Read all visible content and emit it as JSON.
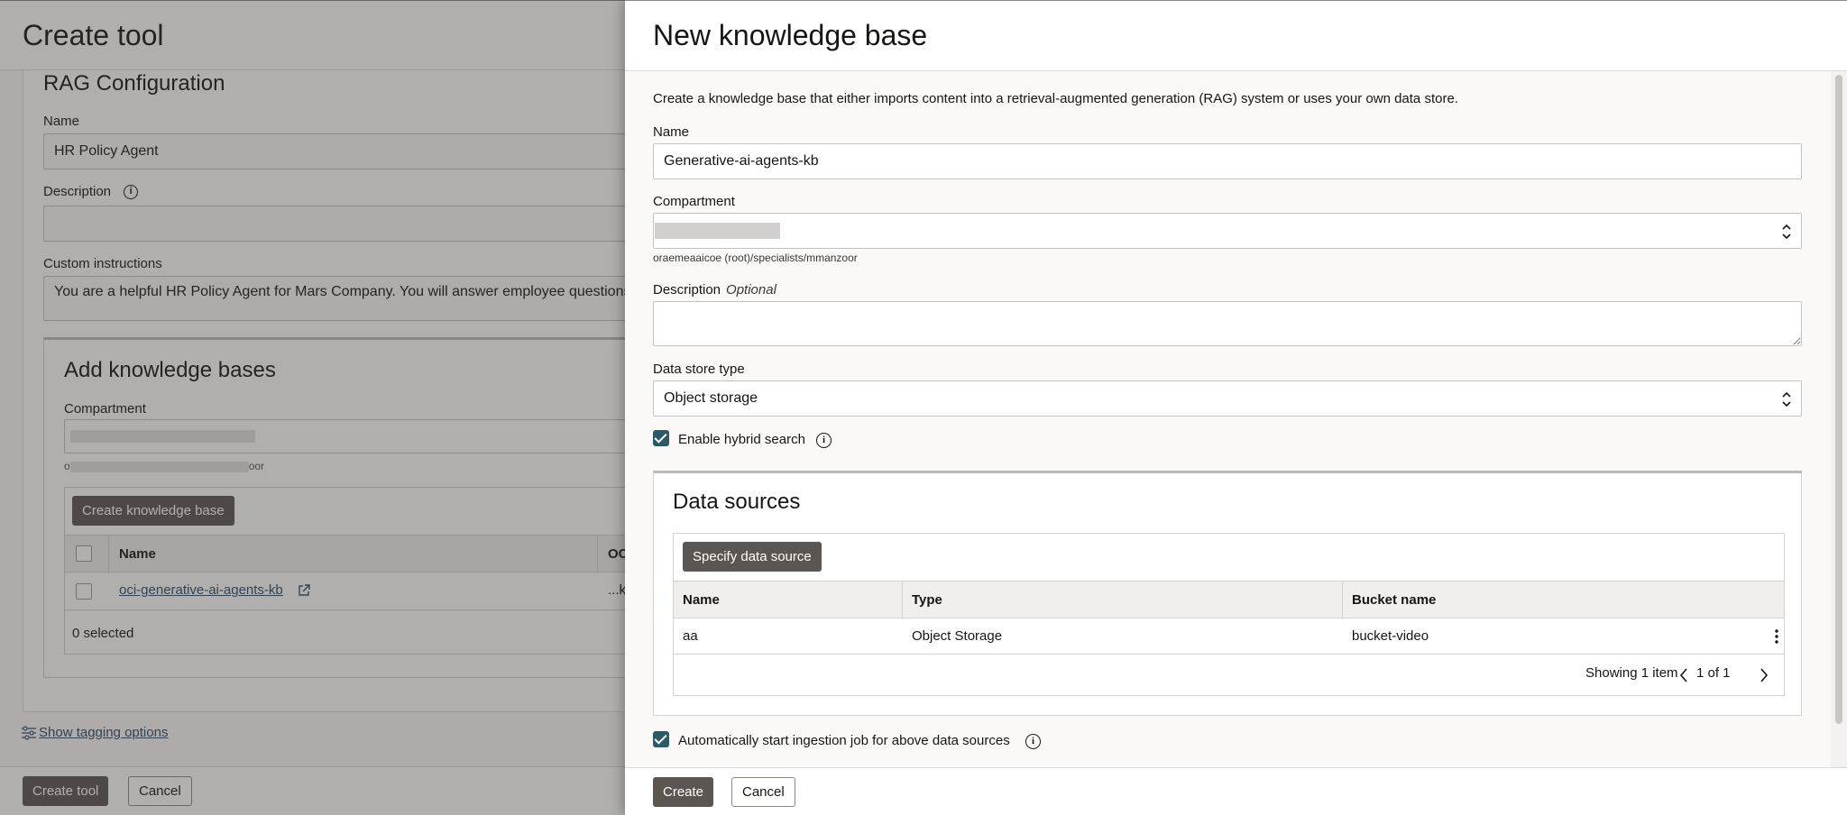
{
  "background_page": {
    "title": "Create tool",
    "section_title": "RAG Configuration",
    "name_label": "Name",
    "name_value": "HR Policy Agent",
    "description_label": "Description",
    "custom_instructions_label": "Custom instructions",
    "custom_instructions_value": "You are a helpful HR Policy Agent for Mars Company. You will answer employee questions ba",
    "add_kb_title": "Add knowledge bases",
    "compartment_label": "Compartment",
    "compartment_path_prefix": "o",
    "compartment_path_suffix": "oor",
    "create_kb_button": "Create knowledge base",
    "table_headers": [
      "Name",
      "OC"
    ],
    "row_link": "oci-generative-ai-agents-kb",
    "row_col2": "...k",
    "selected_count": "0 selected",
    "tagging_link": "Show tagging options",
    "create_tool_button": "Create tool",
    "cancel_button": "Cancel"
  },
  "drawer": {
    "title": "New knowledge base",
    "intro": "Create a knowledge base that either imports content into a retrieval-augmented generation (RAG) system or uses your own data store.",
    "name_label": "Name",
    "name_value": "Generative-ai-agents-kb",
    "compartment_label": "Compartment",
    "compartment_path": "oraemeaaicoe (root)/specialists/mmanzoor",
    "description_label": "Description",
    "description_optional": "Optional",
    "data_store_label": "Data store type",
    "data_store_value": "Object storage",
    "hybrid_search_label": "Enable hybrid search",
    "data_sources": {
      "title": "Data sources",
      "specify_button": "Specify data source",
      "headers": [
        "Name",
        "Type",
        "Bucket name"
      ],
      "rows": [
        {
          "name": "aa",
          "type": "Object Storage",
          "bucket": "bucket-video"
        }
      ],
      "showing": "Showing 1 item",
      "page": "1 of 1"
    },
    "auto_ingest_label": "Automatically start ingestion job for above data sources",
    "create_button": "Create",
    "cancel_button": "Cancel"
  },
  "colors": {
    "checkbox": "#2c5967",
    "dark_button": "#5b5652",
    "link": "#2c4b69"
  }
}
